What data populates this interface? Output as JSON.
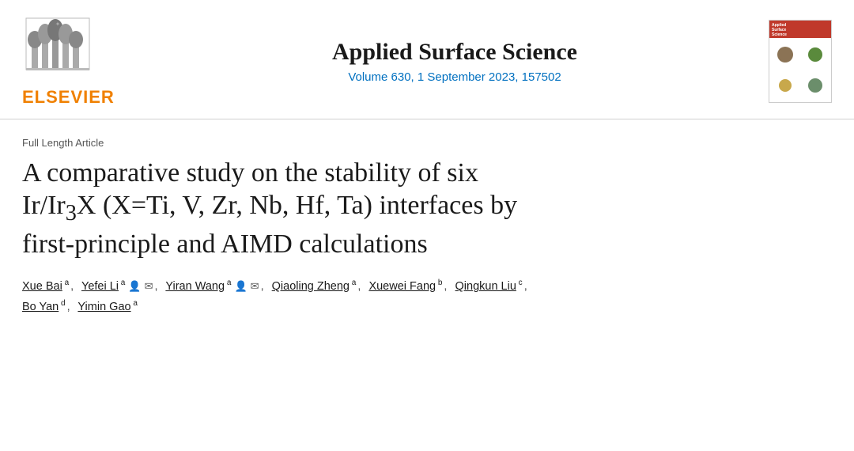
{
  "header": {
    "elsevier_text": "ELSEVIER",
    "journal_title": "Applied Surface Science",
    "journal_meta": "Volume 630, 1 September 2023, 157502",
    "cover_alt": "Applied Surface Science journal cover"
  },
  "article": {
    "type": "Full Length Article",
    "title_part1": "A comparative study on the stability of six",
    "title_part2": "Ir/Ir",
    "title_sub": "3",
    "title_part3": "X (X=Ti, V, Zr, Nb, Hf, Ta) interfaces by",
    "title_part4": "first-principle and AIMD calculations",
    "authors": [
      {
        "name": "Xue Bai",
        "sup": "a",
        "icons": []
      },
      {
        "name": "Yefei Li",
        "sup": "a",
        "icons": [
          "person",
          "email"
        ]
      },
      {
        "name": "Yiran Wang",
        "sup": "a",
        "icons": [
          "person",
          "email"
        ]
      },
      {
        "name": "Qiaoling Zheng",
        "sup": "a",
        "icons": []
      },
      {
        "name": "Xuewei Fang",
        "sup": "b",
        "icons": []
      },
      {
        "name": "Qingkun Liu",
        "sup": "c",
        "icons": []
      },
      {
        "name": "Bo Yan",
        "sup": "d",
        "icons": []
      },
      {
        "name": "Yimin Gao",
        "sup": "a",
        "icons": []
      }
    ]
  }
}
